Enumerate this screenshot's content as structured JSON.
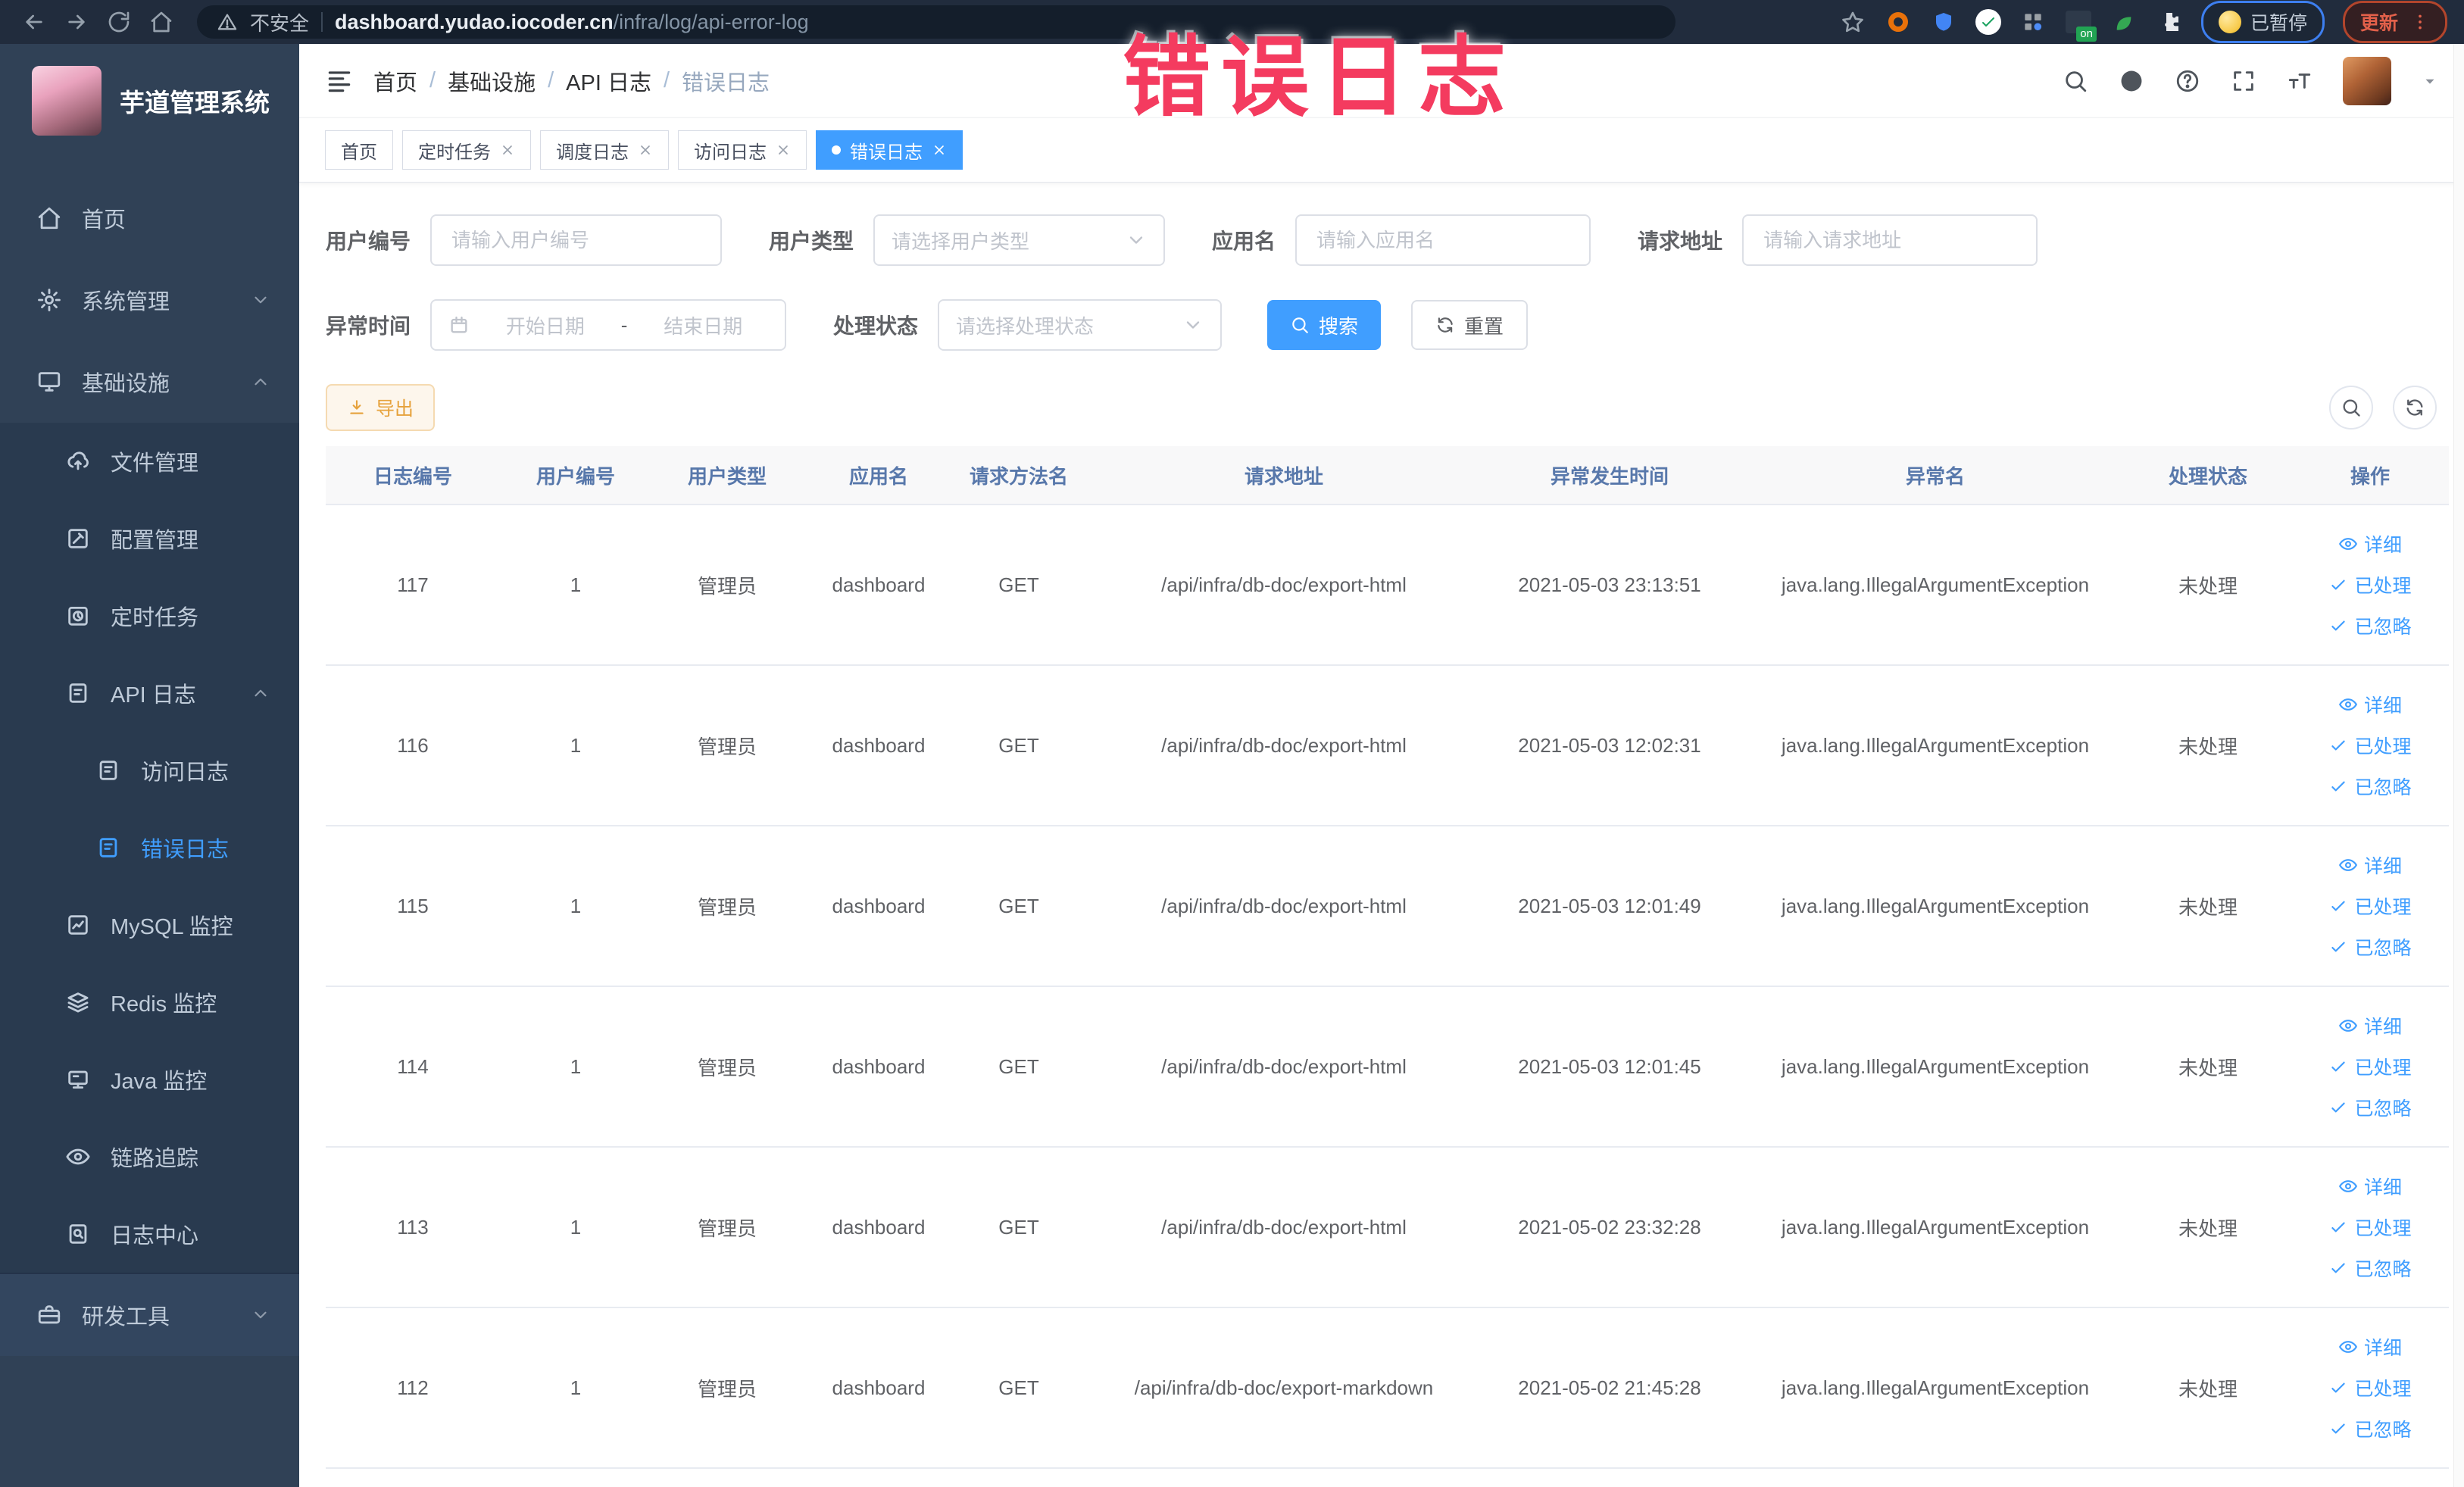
{
  "browser": {
    "security_label": "不安全",
    "url_host": "dashboard.yudao.iocoder.cn",
    "url_path": "/infra/log/api-error-log",
    "extension_badge": "on",
    "paused_badge": "已暂停",
    "update_button": "更新"
  },
  "annotation": {
    "text": "错误日志",
    "color": "#f43b5f"
  },
  "sidebar": {
    "title": "芋道管理系统",
    "items": [
      {
        "name": "home",
        "label": "首页",
        "icon": "home-icon",
        "level": 0
      },
      {
        "name": "system-management",
        "label": "系统管理",
        "icon": "gear-icon",
        "level": 0,
        "chevron": "down"
      },
      {
        "name": "infrastructure",
        "label": "基础设施",
        "icon": "monitor-icon",
        "level": 0,
        "chevron": "up"
      },
      {
        "name": "file-management",
        "label": "文件管理",
        "icon": "upload-cloud-icon",
        "level": 1
      },
      {
        "name": "config-management",
        "label": "配置管理",
        "icon": "edit-square-icon",
        "level": 1
      },
      {
        "name": "scheduled-jobs",
        "label": "定时任务",
        "icon": "clock-square-icon",
        "level": 1
      },
      {
        "name": "api-log",
        "label": "API 日志",
        "icon": "doc-edit-icon",
        "level": 1,
        "chevron": "up"
      },
      {
        "name": "access-log",
        "label": "访问日志",
        "icon": "doc-edit-icon",
        "level": 2
      },
      {
        "name": "error-log",
        "label": "错误日志",
        "icon": "doc-edit-icon",
        "level": 2,
        "active": true
      },
      {
        "name": "mysql-monitor",
        "label": "MySQL 监控",
        "icon": "chart-square-icon",
        "level": 1
      },
      {
        "name": "redis-monitor",
        "label": "Redis 监控",
        "icon": "layers-icon",
        "level": 1
      },
      {
        "name": "java-monitor",
        "label": "Java 监控",
        "icon": "screen-icon",
        "level": 1
      },
      {
        "name": "trace",
        "label": "链路追踪",
        "icon": "eye-icon",
        "level": 1
      },
      {
        "name": "log-center",
        "label": "日志中心",
        "icon": "doc-search-icon",
        "level": 1
      },
      {
        "name": "dev-tools",
        "label": "研发工具",
        "icon": "briefcase-icon",
        "level": 0,
        "chevron": "down",
        "section_top": true
      }
    ]
  },
  "header": {
    "breadcrumb": [
      "首页",
      "基础设施",
      "API 日志",
      "错误日志"
    ]
  },
  "tabs": [
    {
      "name": "home",
      "label": "首页",
      "closable": false,
      "active": false
    },
    {
      "name": "job",
      "label": "定时任务",
      "closable": true,
      "active": false
    },
    {
      "name": "job-log",
      "label": "调度日志",
      "closable": true,
      "active": false
    },
    {
      "name": "access-log",
      "label": "访问日志",
      "closable": true,
      "active": false
    },
    {
      "name": "error-log",
      "label": "错误日志",
      "closable": true,
      "active": true
    }
  ],
  "filters": {
    "user_id": {
      "label": "用户编号",
      "placeholder": "请输入用户编号"
    },
    "user_type": {
      "label": "用户类型",
      "placeholder": "请选择用户类型"
    },
    "app_name": {
      "label": "应用名",
      "placeholder": "请输入应用名"
    },
    "request_url": {
      "label": "请求地址",
      "placeholder": "请输入请求地址"
    },
    "exception_time": {
      "label": "异常时间",
      "start_placeholder": "开始日期",
      "separator": "-",
      "end_placeholder": "结束日期"
    },
    "process_status": {
      "label": "处理状态",
      "placeholder": "请选择处理状态"
    },
    "search_button": "搜索",
    "reset_button": "重置"
  },
  "toolbar": {
    "export_label": "导出"
  },
  "table": {
    "columns": [
      "日志编号",
      "用户编号",
      "用户类型",
      "应用名",
      "请求方法名",
      "请求地址",
      "异常发生时间",
      "异常名",
      "处理状态",
      "操作"
    ],
    "row_actions": [
      "详细",
      "已处理",
      "已忽略"
    ],
    "rows": [
      {
        "log_id": "117",
        "user_id": "1",
        "user_type": "管理员",
        "app_name": "dashboard",
        "method": "GET",
        "url": "/api/infra/db-doc/export-html",
        "time": "2021-05-03 23:13:51",
        "exception": "java.lang.IllegalArgumentException",
        "status": "未处理"
      },
      {
        "log_id": "116",
        "user_id": "1",
        "user_type": "管理员",
        "app_name": "dashboard",
        "method": "GET",
        "url": "/api/infra/db-doc/export-html",
        "time": "2021-05-03 12:02:31",
        "exception": "java.lang.IllegalArgumentException",
        "status": "未处理"
      },
      {
        "log_id": "115",
        "user_id": "1",
        "user_type": "管理员",
        "app_name": "dashboard",
        "method": "GET",
        "url": "/api/infra/db-doc/export-html",
        "time": "2021-05-03 12:01:49",
        "exception": "java.lang.IllegalArgumentException",
        "status": "未处理"
      },
      {
        "log_id": "114",
        "user_id": "1",
        "user_type": "管理员",
        "app_name": "dashboard",
        "method": "GET",
        "url": "/api/infra/db-doc/export-html",
        "time": "2021-05-03 12:01:45",
        "exception": "java.lang.IllegalArgumentException",
        "status": "未处理"
      },
      {
        "log_id": "113",
        "user_id": "1",
        "user_type": "管理员",
        "app_name": "dashboard",
        "method": "GET",
        "url": "/api/infra/db-doc/export-html",
        "time": "2021-05-02 23:32:28",
        "exception": "java.lang.IllegalArgumentException",
        "status": "未处理"
      },
      {
        "log_id": "112",
        "user_id": "1",
        "user_type": "管理员",
        "app_name": "dashboard",
        "method": "GET",
        "url": "/api/infra/db-doc/export-markdown",
        "time": "2021-05-02 21:45:28",
        "exception": "java.lang.IllegalArgumentException",
        "status": "未处理"
      }
    ]
  },
  "icons": {
    "search-icon": "magnifier",
    "refresh-icon": "circular-arrows",
    "download-icon": "arrow-down-tray",
    "eye-icon": "eye",
    "check-icon": "checkmark",
    "close-icon": "x",
    "calendar-icon": "calendar",
    "chevron-down-icon": "v",
    "chevron-up-icon": "^",
    "github-icon": "octocat-circle",
    "help-icon": "question-circle",
    "fullscreen-icon": "corner-arrows",
    "font-size-icon": "double-T",
    "warning-icon": "triangle-exclamation",
    "star-icon": "bookmark-star",
    "kebab-icon": "three-dots"
  },
  "colors": {
    "primary": "#409eff",
    "warning": "#e6a23c",
    "annotation_pink": "#f43b5f",
    "sidebar_bg": "#304156",
    "browser_bar": "#212c3d"
  }
}
